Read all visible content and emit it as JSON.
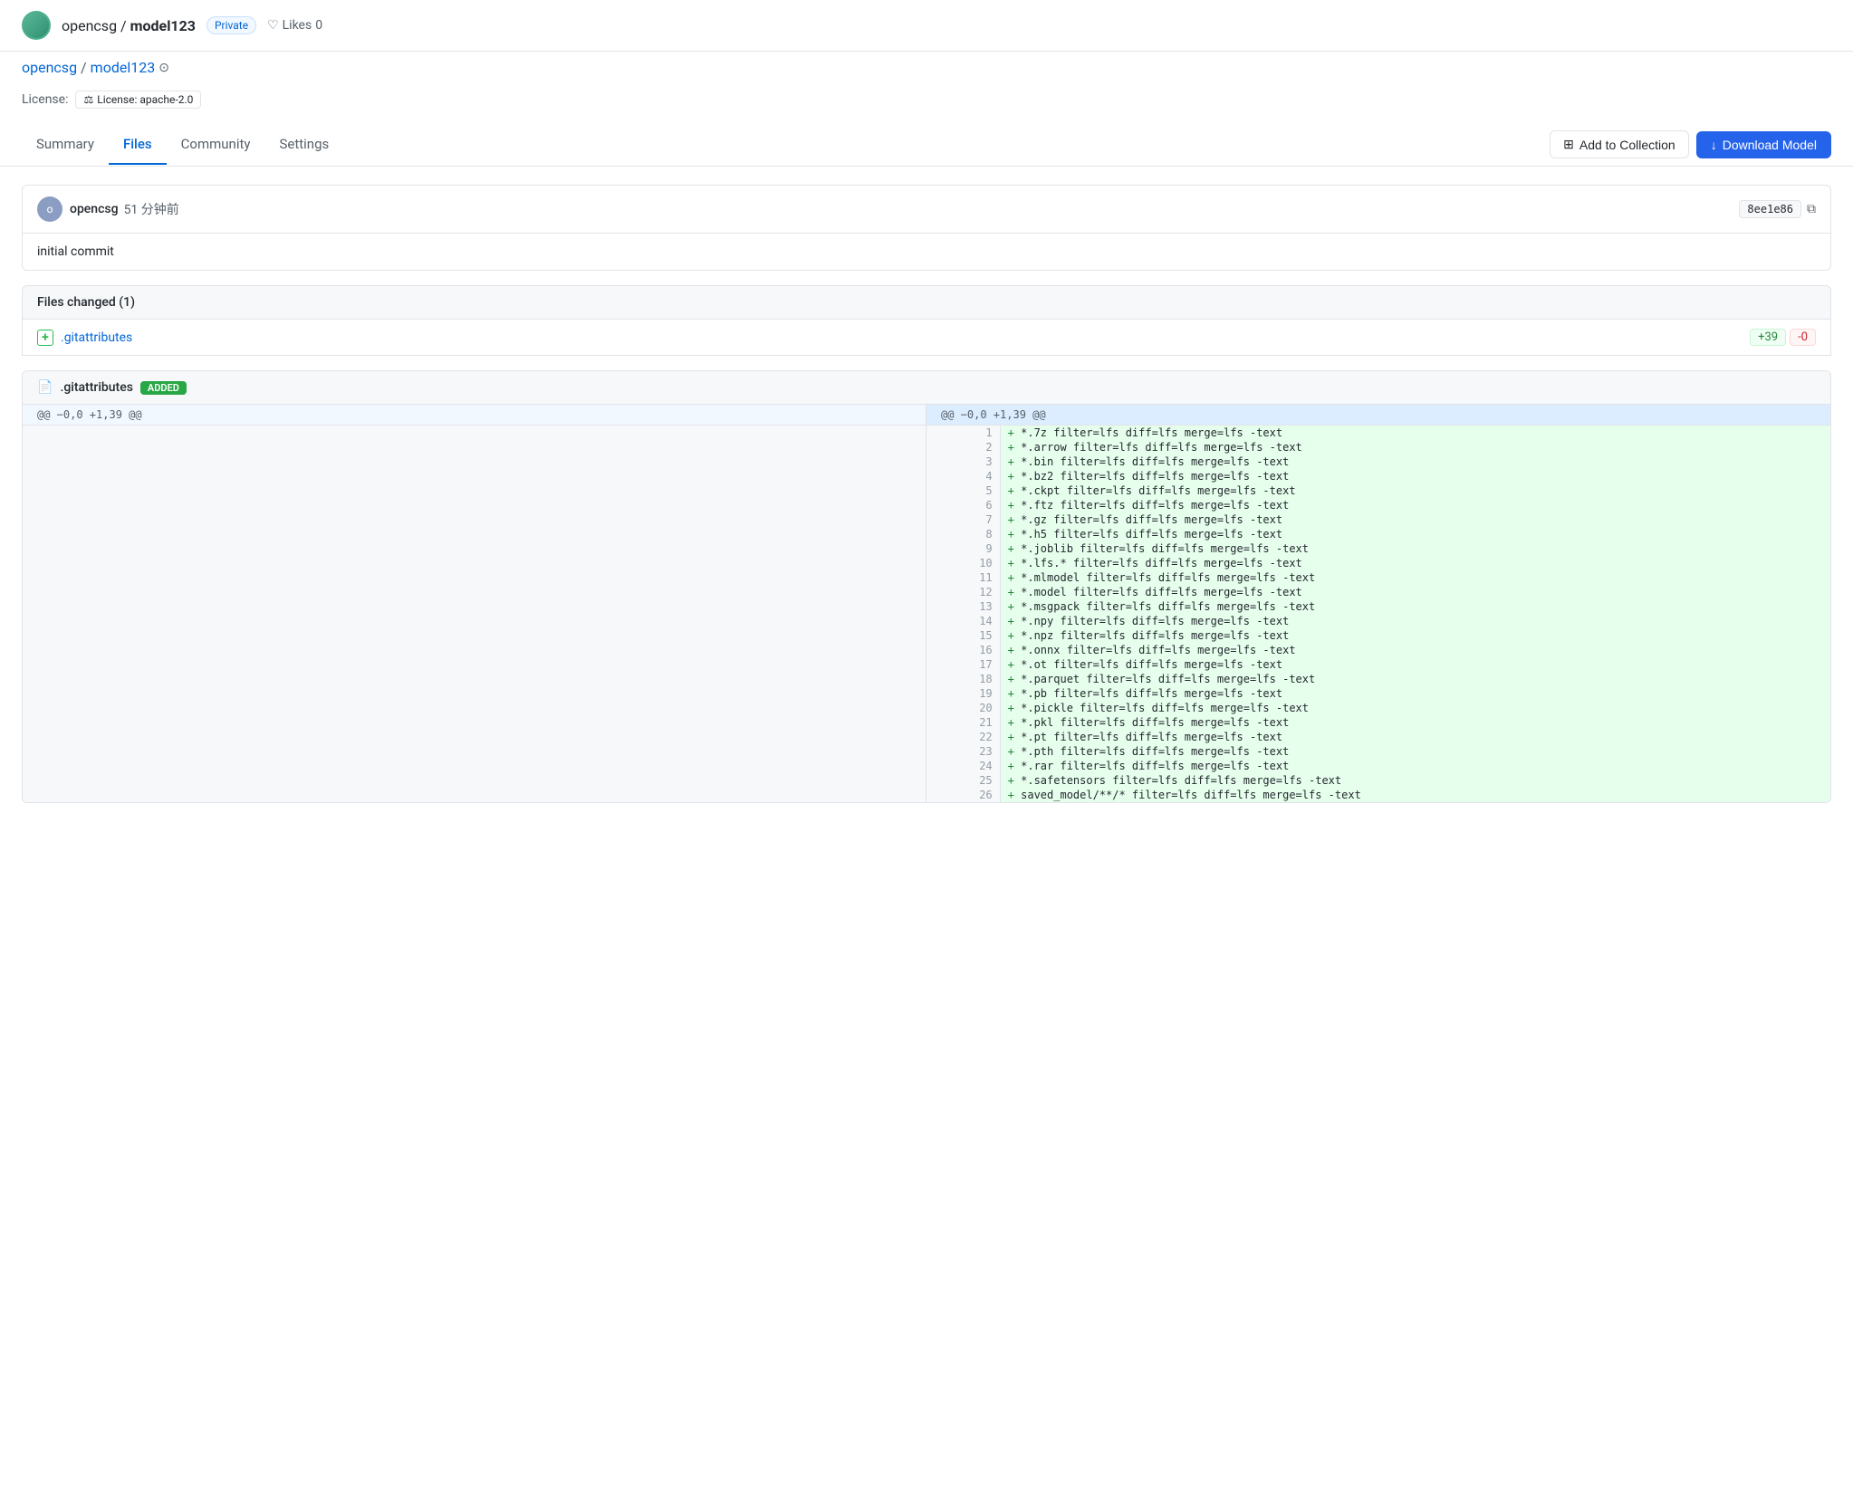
{
  "header": {
    "logo_alt": "opencsg logo",
    "repo_user": "opencsg",
    "repo_name": "model123",
    "badge_private": "Private",
    "likes_label": "Likes",
    "likes_count": "0"
  },
  "breadcrumb": {
    "user": "opencsg",
    "separator": "/",
    "repo": "model123"
  },
  "license": {
    "label": "License:",
    "badge_icon": "⚖",
    "badge_text": "License: apache-2.0"
  },
  "tabs": {
    "items": [
      {
        "id": "summary",
        "label": "Summary"
      },
      {
        "id": "files",
        "label": "Files"
      },
      {
        "id": "community",
        "label": "Community"
      },
      {
        "id": "settings",
        "label": "Settings"
      }
    ],
    "active": "files",
    "btn_collection": "Add to Collection",
    "btn_download": "Download Model"
  },
  "commit": {
    "author": "opencsg",
    "avatar_initials": "o",
    "time": "51 分钟前",
    "hash": "8ee1e86",
    "message": "initial commit"
  },
  "files_changed": {
    "label": "Files changed (1)",
    "file": ".gitattributes",
    "stat_added": "+39",
    "stat_removed": "-0"
  },
  "diff": {
    "file_name": ".gitattributes",
    "badge": "ADDED",
    "hunk": "@@ −0,0 +1,39 @@",
    "lines": [
      {
        "num": 1,
        "content": "+ *.7z filter=lfs diff=lfs merge=lfs -text"
      },
      {
        "num": 2,
        "content": "+ *.arrow filter=lfs diff=lfs merge=lfs -text"
      },
      {
        "num": 3,
        "content": "+ *.bin filter=lfs diff=lfs merge=lfs -text"
      },
      {
        "num": 4,
        "content": "+ *.bz2 filter=lfs diff=lfs merge=lfs -text"
      },
      {
        "num": 5,
        "content": "+ *.ckpt filter=lfs diff=lfs merge=lfs -text"
      },
      {
        "num": 6,
        "content": "+ *.ftz filter=lfs diff=lfs merge=lfs -text"
      },
      {
        "num": 7,
        "content": "+ *.gz filter=lfs diff=lfs merge=lfs -text"
      },
      {
        "num": 8,
        "content": "+ *.h5 filter=lfs diff=lfs merge=lfs -text"
      },
      {
        "num": 9,
        "content": "+ *.joblib filter=lfs diff=lfs merge=lfs -text"
      },
      {
        "num": 10,
        "content": "+ *.lfs.* filter=lfs diff=lfs merge=lfs -text"
      },
      {
        "num": 11,
        "content": "+ *.mlmodel filter=lfs diff=lfs merge=lfs -text"
      },
      {
        "num": 12,
        "content": "+ *.model filter=lfs diff=lfs merge=lfs -text"
      },
      {
        "num": 13,
        "content": "+ *.msgpack filter=lfs diff=lfs merge=lfs -text"
      },
      {
        "num": 14,
        "content": "+ *.npy filter=lfs diff=lfs merge=lfs -text"
      },
      {
        "num": 15,
        "content": "+ *.npz filter=lfs diff=lfs merge=lfs -text"
      },
      {
        "num": 16,
        "content": "+ *.onnx filter=lfs diff=lfs merge=lfs -text"
      },
      {
        "num": 17,
        "content": "+ *.ot filter=lfs diff=lfs merge=lfs -text"
      },
      {
        "num": 18,
        "content": "+ *.parquet filter=lfs diff=lfs merge=lfs -text"
      },
      {
        "num": 19,
        "content": "+ *.pb filter=lfs diff=lfs merge=lfs -text"
      },
      {
        "num": 20,
        "content": "+ *.pickle filter=lfs diff=lfs merge=lfs -text"
      },
      {
        "num": 21,
        "content": "+ *.pkl filter=lfs diff=lfs merge=lfs -text"
      },
      {
        "num": 22,
        "content": "+ *.pt filter=lfs diff=lfs merge=lfs -text"
      },
      {
        "num": 23,
        "content": "+ *.pth filter=lfs diff=lfs merge=lfs -text"
      },
      {
        "num": 24,
        "content": "+ *.rar filter=lfs diff=lfs merge=lfs -text"
      },
      {
        "num": 25,
        "content": "+ *.safetensors filter=lfs diff=lfs merge=lfs -text"
      },
      {
        "num": 26,
        "content": "+ saved_model/**/* filter=lfs diff=lfs merge=lfs -text"
      }
    ]
  }
}
